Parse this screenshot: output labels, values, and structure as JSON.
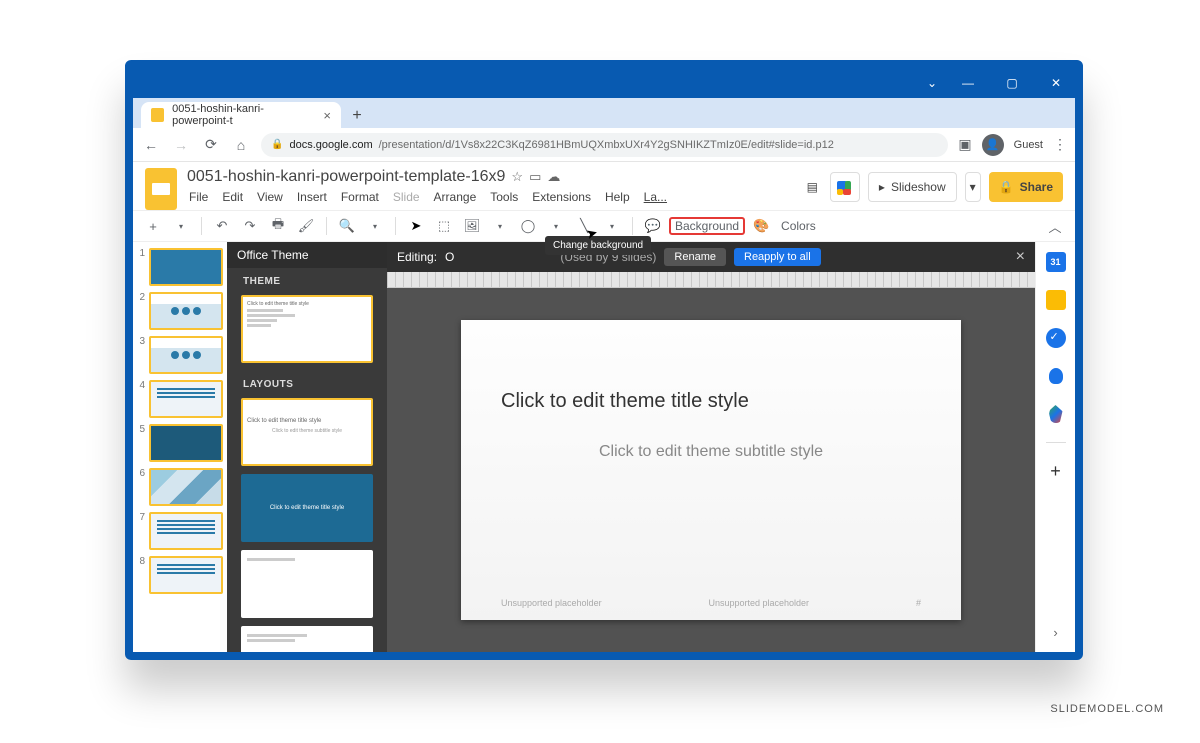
{
  "window": {
    "tab_title": "0051-hoshin-kanri-powerpoint-t",
    "url_host": "docs.google.com",
    "url_path": "/presentation/d/1Vs8x22C3KqZ6981HBmUQXmbxUXr4Y2gSNHIKZTmIz0E/edit#slide=id.p12",
    "guest": "Guest"
  },
  "doc": {
    "name": "0051-hoshin-kanri-powerpoint-template-16x9"
  },
  "menus": [
    "File",
    "Edit",
    "View",
    "Insert",
    "Format",
    "Slide",
    "Arrange",
    "Tools",
    "Extensions",
    "Help",
    "La..."
  ],
  "header_buttons": {
    "slideshow": "Slideshow",
    "share": "Share"
  },
  "toolbar": {
    "background": "Background",
    "colors": "Colors",
    "tooltip": "Change background"
  },
  "theme_panel": {
    "title": "Office Theme",
    "theme_label": "THEME",
    "layouts_label": "LAYOUTS",
    "theme_thumb_text": "Click to edit theme title style",
    "layout_thumb_text": "Click to edit theme title style",
    "layout_thumb_sub": "Click to edit theme subtitle style"
  },
  "editor": {
    "editing_prefix": "Editing:",
    "editing_name": "O",
    "used_by": "(Used by 9 slides)",
    "rename": "Rename",
    "reapply": "Reapply to all",
    "title_ph": "Click to edit theme title style",
    "subtitle_ph": "Click to edit theme subtitle style",
    "footer_left": "Unsupported placeholder",
    "footer_mid": "Unsupported placeholder",
    "footer_right": "#"
  },
  "side_cal": "31",
  "slides": [
    1,
    2,
    3,
    4,
    5,
    6,
    7,
    8
  ],
  "watermark": "SLIDEMODEL.COM"
}
